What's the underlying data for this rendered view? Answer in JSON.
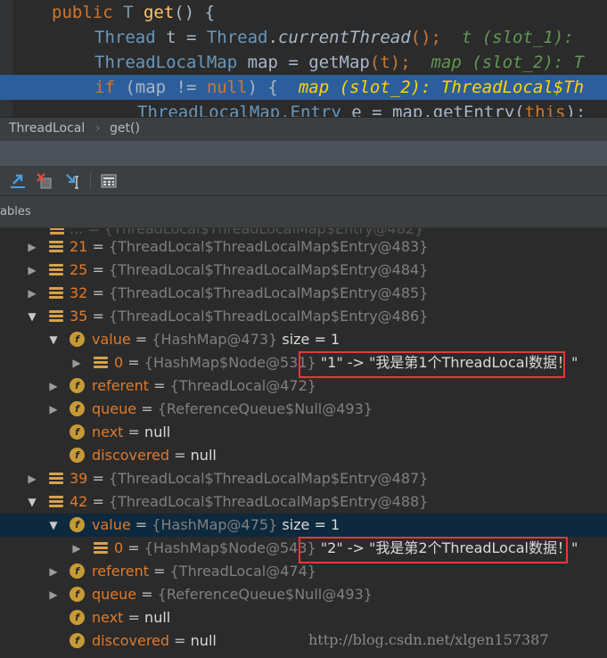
{
  "editor": {
    "lines": [
      {
        "p1": "public ",
        "p2": "T ",
        "p3": "get",
        "p4": "() {"
      },
      {
        "p1": "Thread ",
        "p2": "t = ",
        "p3": "Thread",
        "p4": ".",
        "p5": "currentThread",
        "p6": "();",
        "hint": "  t (slot_1):"
      },
      {
        "p1": "ThreadLocalMap ",
        "p2": "map = ",
        "p3": "getMap",
        "p4": "(t);",
        "hint": "  map (slot_2): T"
      },
      {
        "p1": "if ",
        "p2": "(map != ",
        "p3": "null",
        "p4": ") {",
        "hint": "  map (slot_2): ThreadLocal$Th"
      },
      {
        "p1": "ThreadLocalMap.Entry ",
        "p2": "e = map.",
        "p3": "getEntry",
        "p4": "(",
        "p5": "this",
        "p6": ");"
      }
    ]
  },
  "breadcrumb": {
    "class_name": "ThreadLocal",
    "sep": "›",
    "method": "get()"
  },
  "variables_header": {
    "label": "ables"
  },
  "tree": {
    "rows": [
      {
        "key": "21",
        "value": "{ThreadLocal$ThreadLocalMap$Entry@483}"
      },
      {
        "key": "25",
        "value": "{ThreadLocal$ThreadLocalMap$Entry@484}"
      },
      {
        "key": "32",
        "value": "{ThreadLocal$ThreadLocalMap$Entry@485}"
      },
      {
        "key": "35",
        "value": "{ThreadLocal$ThreadLocalMap$Entry@486}"
      },
      {
        "key": "value",
        "value": "{HashMap@473}",
        "extra": "size = 1"
      },
      {
        "key": "0",
        "value": "{HashMap$Node@531}",
        "boxed": "\"1\" -> \"我是第1个ThreadLocal数据！\""
      },
      {
        "key": "referent",
        "value": "{ThreadLocal@472}"
      },
      {
        "key": "queue",
        "value": "{ReferenceQueue$Null@493}"
      },
      {
        "key": "next",
        "value": "null"
      },
      {
        "key": "discovered",
        "value": "null"
      },
      {
        "key": "39",
        "value": "{ThreadLocal$ThreadLocalMap$Entry@487}"
      },
      {
        "key": "42",
        "value": "{ThreadLocal$ThreadLocalMap$Entry@488}"
      },
      {
        "key": "value",
        "value": "{HashMap@475}",
        "extra": "size = 1"
      },
      {
        "key": "0",
        "value": "{HashMap$Node@543}",
        "boxed": "\"2\" -> \"我是第2个ThreadLocal数据！\""
      },
      {
        "key": "referent",
        "value": "{ThreadLocal@474}"
      },
      {
        "key": "queue",
        "value": "{ReferenceQueue$Null@493}"
      },
      {
        "key": "next",
        "value": "null"
      },
      {
        "key": "discovered",
        "value": "null"
      }
    ],
    "eq": "="
  },
  "watermark": "http://blog.csdn.net/xlgen157387",
  "colors": {
    "accent_highlight": "#2d5e9c",
    "selected_row": "#0d293e",
    "annotation_box": "#e53935",
    "entry_icon": "#d6a24a",
    "field_icon": "#c79a35"
  }
}
